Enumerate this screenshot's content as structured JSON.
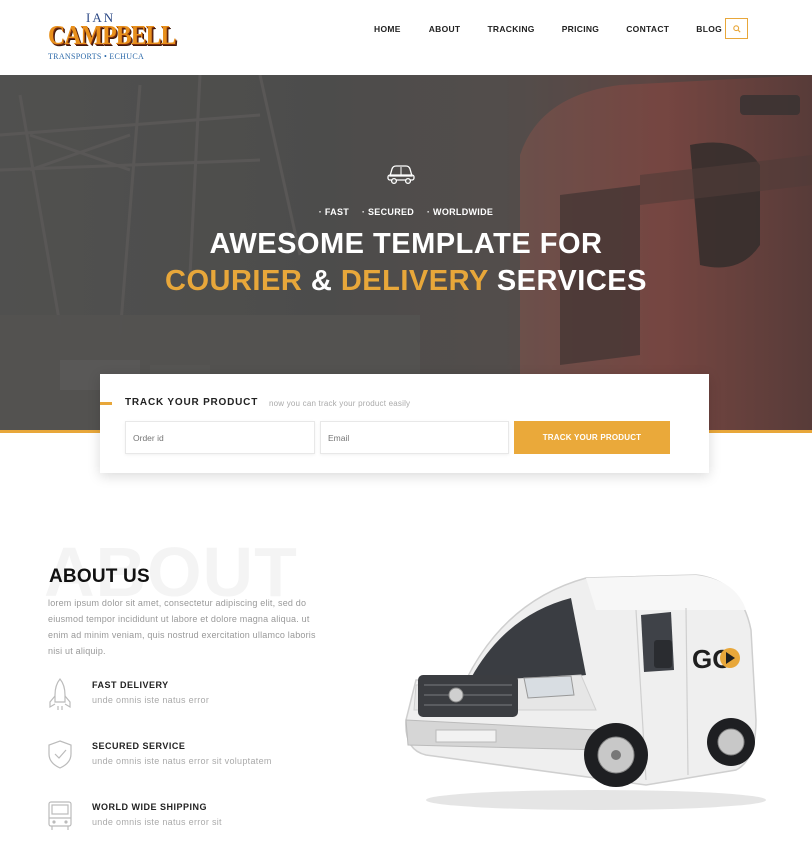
{
  "brand": {
    "logo_top": "IAN",
    "logo_main": "CAMPBELL",
    "logo_sub": "TRANSPORTS • ECHUCA"
  },
  "nav": {
    "items": [
      {
        "label": "HOME"
      },
      {
        "label": "ABOUT"
      },
      {
        "label": "TRACKING"
      },
      {
        "label": "PRICING"
      },
      {
        "label": "CONTACT"
      },
      {
        "label": "BLOG"
      }
    ],
    "search_icon": "search-icon"
  },
  "hero": {
    "icon": "car-icon",
    "tags": [
      "· FAST",
      "· SECURED",
      "· WORLDWIDE"
    ],
    "line1": "AWESOME TEMPLATE FOR",
    "line2_a": "COURIER",
    "line2_amp": " & ",
    "line2_b": "DELIVERY",
    "line2_c": " SERVICES"
  },
  "tracking": {
    "title": "TRACK YOUR PRODUCT",
    "subtitle": "now you can track your product easily",
    "order_placeholder": "Order id",
    "email_placeholder": "Email",
    "button_label": "TRACK YOUR PRODUCT"
  },
  "about": {
    "bg_text": "ABOUT",
    "title": "ABOUT US",
    "desc": "lorem ipsum dolor sit amet, consectetur adipiscing elit, sed do eiusmod tempor incididunt ut labore et dolore magna aliqua. ut enim ad minim veniam, quis nostrud exercitation ullamco laboris nisi ut aliquip.",
    "features": [
      {
        "icon": "rocket-icon",
        "title": "FAST DELIVERY",
        "desc": "unde omnis iste natus error"
      },
      {
        "icon": "shield-icon",
        "title": "SECURED SERVICE",
        "desc": "unde omnis iste natus error sit voluptatem"
      },
      {
        "icon": "truck-icon",
        "title": "WORLD WIDE SHIPPING",
        "desc": "unde omnis iste natus error sit"
      }
    ],
    "van_badge": "GO"
  },
  "colors": {
    "accent": "#e8a73a",
    "hero_overlay": "#555555"
  }
}
